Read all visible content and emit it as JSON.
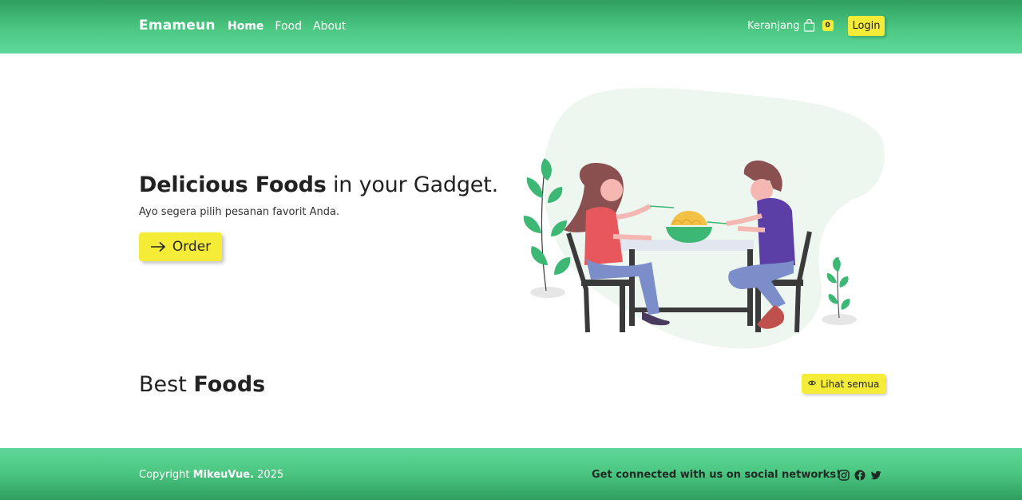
{
  "navbar": {
    "brand": "Emameun",
    "links": [
      {
        "label": "Home",
        "active": true
      },
      {
        "label": "Food",
        "active": false
      },
      {
        "label": "About",
        "active": false
      }
    ],
    "cart_label": "Keranjang",
    "cart_count": "0",
    "cart_icon": "shopping-bag-icon",
    "login_label": "Login"
  },
  "hero": {
    "title_bold": "Delicious Foods",
    "title_rest": " in your Gadget.",
    "subtitle": "Ayo segera pilih pesanan favorit Anda.",
    "order_label": "Order",
    "order_icon": "arrow-right-icon"
  },
  "best_foods": {
    "title_light": "Best ",
    "title_bold": "Foods",
    "see_all_label": "Lihat semua",
    "see_all_icon": "eye-icon"
  },
  "footer": {
    "copyright_prefix": "Copyright ",
    "copyright_brand": "MikeuVue.",
    "copyright_year": " 2025",
    "social_text": "Get connected with us on social networks!",
    "social_icons": [
      "instagram-icon",
      "facebook-icon",
      "twitter-icon"
    ]
  },
  "colors": {
    "accent_green": "#4cc882",
    "dark_green": "#2f9e5f",
    "button_yellow": "#f5ec37"
  }
}
